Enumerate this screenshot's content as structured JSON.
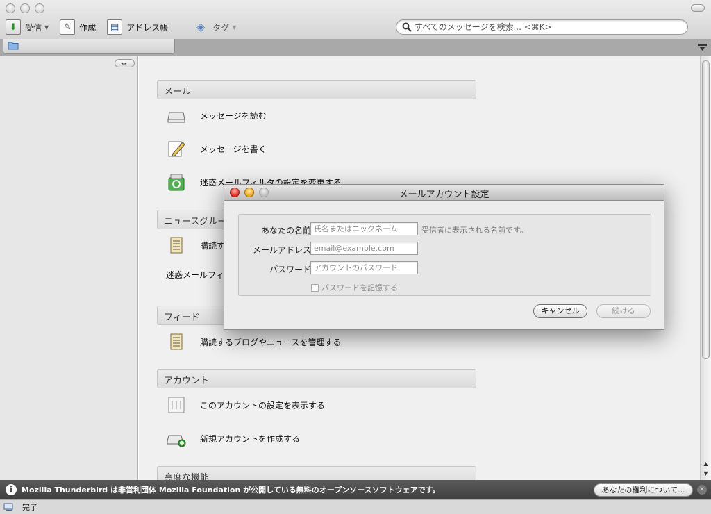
{
  "toolbar": {
    "get_mail_label": "受信",
    "write_label": "作成",
    "address_book_label": "アドレス帳",
    "tag_label": "タグ"
  },
  "search": {
    "placeholder": "すべてのメッセージを検索... <⌘K>"
  },
  "sections": {
    "mail": {
      "header": "メール",
      "read_messages": "メッセージを読む",
      "write_message": "メッセージを書く",
      "junk_settings": "迷惑メールフィルタの設定を変更する"
    },
    "news": {
      "header": "ニュースグループ",
      "subscribe": "購読す",
      "junk_settings": "迷惑メールフィル"
    },
    "feeds": {
      "header": "フィード",
      "manage": "購読するブログやニュースを管理する"
    },
    "accounts": {
      "header": "アカウント",
      "view_settings": "このアカウントの設定を表示する",
      "create_account": "新規アカウントを作成する"
    },
    "advanced": {
      "header": "高度な機能"
    }
  },
  "dialog": {
    "title": "メールアカウント設定",
    "name_label": "あなたの名前:",
    "name_placeholder": "氏名またはニックネーム",
    "name_hint": "受信者に表示される名前です。",
    "email_label": "メールアドレス:",
    "email_placeholder": "email@example.com",
    "password_label": "パスワード:",
    "password_placeholder": "アカウントのパスワード",
    "remember_label": "パスワードを記憶する",
    "cancel_label": "キャンセル",
    "continue_label": "続ける"
  },
  "notification": {
    "text": "Mozilla Thunderbird は非営利団体 Mozilla Foundation が公開している無料のオープンソースソフトウェアです。",
    "button": "あなたの権利について..."
  },
  "status": {
    "text": "完了"
  }
}
